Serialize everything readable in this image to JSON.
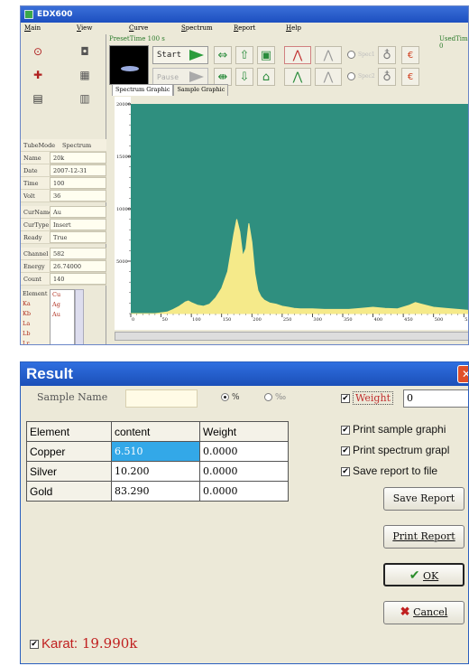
{
  "app": {
    "title": "EDX600",
    "menu": [
      "Main",
      "View",
      "Curve",
      "Spectrum",
      "Report",
      "Help"
    ],
    "preset_time_label": "PresetTime",
    "preset_time_value": "100 s",
    "used_time_label": "UsedTime",
    "used_time_value": "0",
    "start_label": "Start",
    "pause_label": "Pause",
    "spec1_label": "Spec1",
    "spec2_label": "Spec2",
    "tabs": [
      "Spectrum Graphic",
      "Sample Graphic"
    ],
    "info_header": {
      "k": "TubeMode",
      "v": "Spectrum"
    },
    "info_rows": [
      {
        "k": "Name",
        "v": "20k"
      },
      {
        "k": "Date",
        "v": "2007-12-31"
      },
      {
        "k": "Time",
        "v": "100"
      },
      {
        "k": "Volt",
        "v": "36"
      }
    ],
    "info_rows2": [
      {
        "k": "CurName",
        "v": "Au"
      },
      {
        "k": "CurType",
        "v": "Insert"
      },
      {
        "k": "Ready",
        "v": "True"
      }
    ],
    "info_rows3": [
      {
        "k": "Channel",
        "v": "582"
      },
      {
        "k": "Energy",
        "v": "26.74000"
      },
      {
        "k": "Count",
        "v": "140"
      }
    ],
    "element_header": "Element",
    "element_lines": [
      "Ka",
      "Kb",
      "La",
      "Lb",
      "Lr"
    ],
    "element_list": [
      "Cu",
      "Ag",
      "Au"
    ]
  },
  "chart_data": {
    "type": "area",
    "y_ticks": [
      "20000",
      "15000",
      "10000",
      "5000"
    ],
    "x_ticks": [
      "0",
      "50",
      "100",
      "150",
      "200",
      "250",
      "300",
      "350",
      "400",
      "450",
      "500",
      "550"
    ],
    "xlim": [
      0,
      560
    ],
    "ylim": [
      0,
      20000
    ],
    "x": [
      0,
      40,
      60,
      70,
      80,
      85,
      90,
      95,
      100,
      110,
      120,
      130,
      140,
      150,
      160,
      170,
      175,
      180,
      185,
      190,
      195,
      200,
      205,
      210,
      215,
      220,
      230,
      240,
      250,
      260,
      270,
      280,
      300,
      320,
      340,
      360,
      380,
      400,
      420,
      440,
      460,
      470,
      480,
      500,
      520,
      540,
      560
    ],
    "y": [
      0,
      0,
      150,
      400,
      700,
      900,
      1100,
      1200,
      1050,
      800,
      700,
      900,
      1500,
      2400,
      4000,
      7500,
      9000,
      7800,
      5500,
      6200,
      8600,
      6800,
      3800,
      2200,
      1600,
      1300,
      1000,
      900,
      700,
      600,
      500,
      450,
      450,
      400,
      400,
      400,
      500,
      600,
      500,
      450,
      800,
      1050,
      900,
      600,
      500,
      400,
      300
    ],
    "fill_color": "#f5ea8a",
    "bg_color": "#2f8f7f"
  },
  "result": {
    "title": "Result",
    "sample_name_label": "Sample Name",
    "sample_name_value": "",
    "unit_percent": "%",
    "unit_permille": "‰",
    "weight_label": "Weight",
    "weight_value": "0",
    "table_headers": [
      "Element",
      "content",
      "Weight"
    ],
    "rows": [
      {
        "element": "Copper",
        "content": "6.510",
        "weight": "0.0000"
      },
      {
        "element": "Silver",
        "content": "10.200",
        "weight": "0.0000"
      },
      {
        "element": "Gold",
        "content": "83.290",
        "weight": "0.0000"
      }
    ],
    "print_sample": "Print sample graphi",
    "print_spectrum": "Print spectrum grapl",
    "save_to_file": "Save report to file",
    "save_report": "Save Report",
    "print_report": "Print Report",
    "ok": "OK",
    "cancel": "Cancel",
    "karat_label": "Karat:",
    "karat_value": "19.990k",
    "check_mark": "✔",
    "accent_color": "#2f6fe0"
  }
}
